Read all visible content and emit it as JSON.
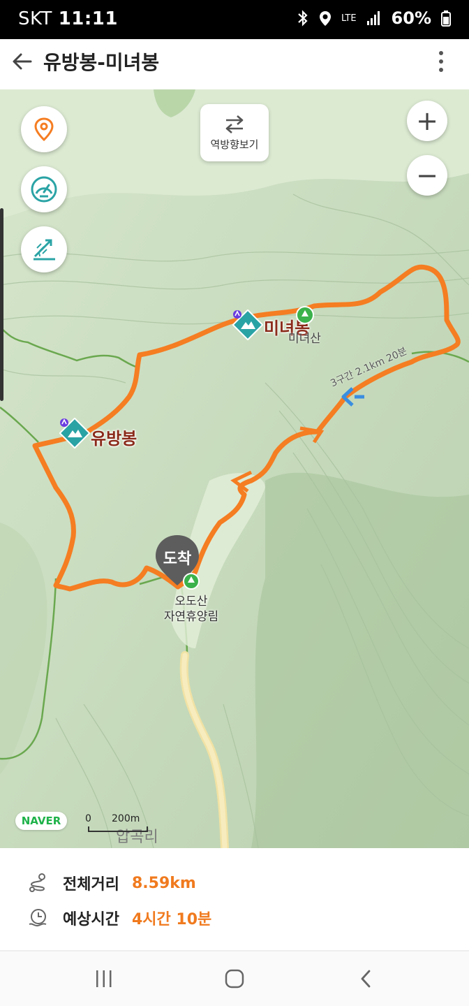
{
  "status_bar": {
    "carrier": "SKT",
    "time": "11:11",
    "network": "LTE",
    "battery": "60%"
  },
  "app_bar": {
    "title": "유방봉-미녀봉"
  },
  "map": {
    "reverse_button_label": "역방향보기",
    "zoom_in_label": "+",
    "zoom_out_label": "−",
    "peaks": [
      {
        "name": "미녀봉"
      },
      {
        "name": "유방봉"
      }
    ],
    "mountain_label": "미녀산",
    "forest_label_line1": "오도산",
    "forest_label_line2": "자연휴양림",
    "trail_label": "3구간 2.1km 20분",
    "village_label": "압곡리",
    "arrival_pin_label": "도착",
    "naver_logo": "NAVER",
    "scale_zero": "0",
    "scale_value": "200m",
    "route_color": "#f57d22"
  },
  "summary": {
    "distance_label": "전체거리",
    "distance_value": "8.59km",
    "time_label": "예상시간",
    "time_value": "4시간 10분"
  },
  "icons": {
    "status": [
      "bluetooth-icon",
      "location-icon",
      "signal-icon",
      "battery-icon"
    ],
    "map_controls": [
      "location-pin-icon",
      "speedometer-icon",
      "elevation-icon",
      "swap-icon"
    ],
    "summary": [
      "route-icon",
      "clock-icon"
    ],
    "nav": [
      "recent-apps-icon",
      "home-icon",
      "back-icon"
    ]
  }
}
